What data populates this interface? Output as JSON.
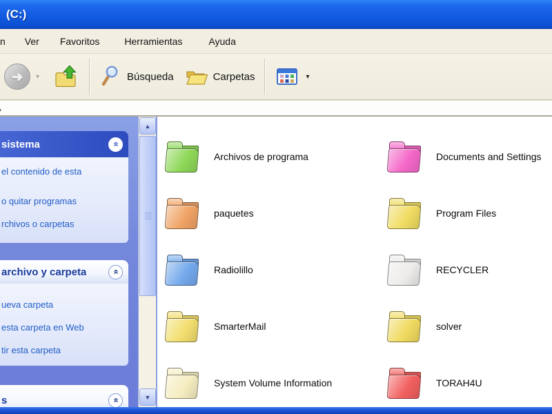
{
  "window": {
    "title": "(C:)"
  },
  "menu": {
    "items": [
      {
        "label": "n",
        "fragment": true
      },
      {
        "label": "Ver",
        "fragment": false
      },
      {
        "label": "Favoritos",
        "fragment": false
      },
      {
        "label": "Herramientas",
        "fragment": false
      },
      {
        "label": "Ayuda",
        "fragment": false
      }
    ]
  },
  "toolbar": {
    "forward_icon": "arrow-right-circle-disabled",
    "forward_glyph": "➜",
    "dropdown_glyph": "▾",
    "up_icon": "folder-up",
    "search_label": "Búsqueda",
    "search_icon": "magnifier",
    "folders_label": "Carpetas",
    "folders_icon": "open-folder",
    "views_icon": "views-grid"
  },
  "address": {
    "fragment": "A"
  },
  "sidebar": {
    "sections": [
      {
        "title": "sistema",
        "style": "blue",
        "chevron": "chevron-up",
        "items": [
          "el contenido de esta",
          "o quitar programas",
          "rchivos o carpetas"
        ]
      },
      {
        "title": "archivo y carpeta",
        "style": "light",
        "chevron": "chevron-up",
        "items": [
          "ueva carpeta",
          "esta carpeta en Web",
          "tir esta carpeta"
        ]
      },
      {
        "title": "s",
        "style": "light",
        "chevron": "chevron-up",
        "items": []
      }
    ]
  },
  "files": {
    "items": [
      {
        "name": "Archivos de programa",
        "color": "#8ED859"
      },
      {
        "name": "paquetes",
        "color": "#F0A365"
      },
      {
        "name": "Radiolillo",
        "color": "#74A9EC"
      },
      {
        "name": "SmarterMail",
        "color": "#F2DE6E"
      },
      {
        "name": "System Volume Information",
        "color": "#F5EDC0"
      },
      {
        "name": "Documents and Settings",
        "color": "#F468C8"
      },
      {
        "name": "Program Files",
        "color": "#F0DC62"
      },
      {
        "name": "RECYCLER",
        "color": "#EDECEA"
      },
      {
        "name": "solver",
        "color": "#F0DA60"
      },
      {
        "name": "TORAH4U",
        "color": "#F26060"
      }
    ]
  },
  "colors": {
    "titlebar_blue": "#125BE2",
    "taskpane_blue": "#7488DC",
    "section_header_blue": "#3352C4",
    "link_blue": "#215DC6",
    "bottom_border_blue": "#1E54D6"
  }
}
